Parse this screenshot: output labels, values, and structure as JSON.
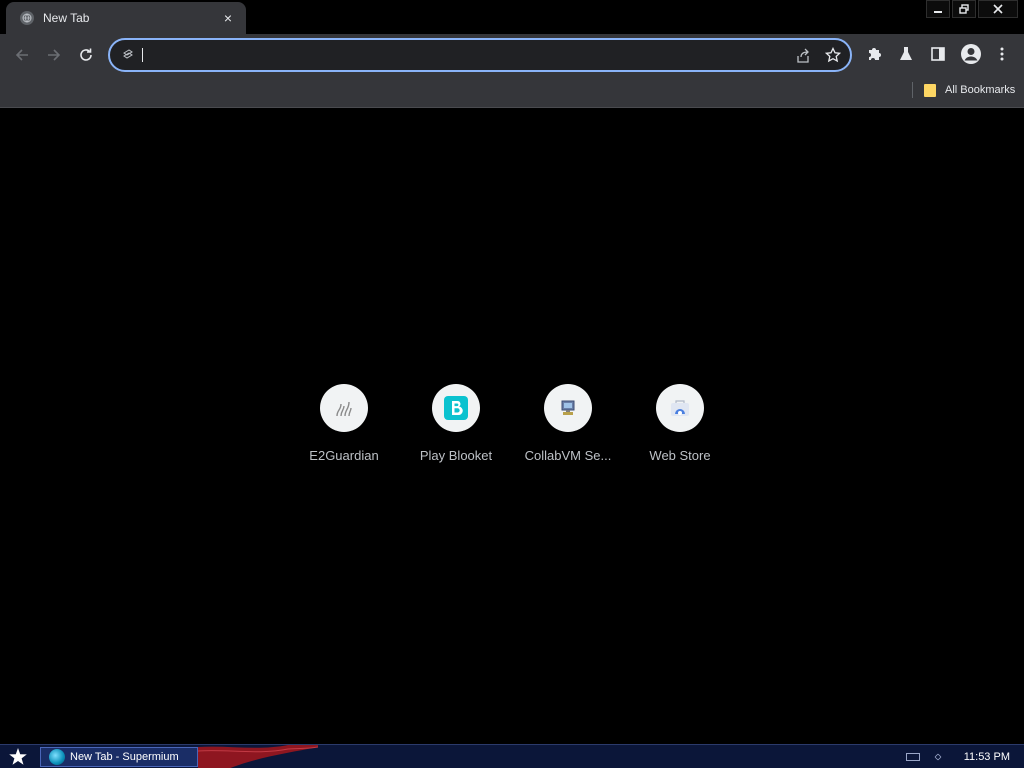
{
  "window": {
    "tab_title": "New Tab",
    "tab_close_glyph": "×",
    "controls": {
      "minimize": "minimize-icon",
      "restore": "restore-icon",
      "close": "close-icon"
    }
  },
  "toolbar": {
    "back_icon": "arrow-left-icon",
    "forward_icon": "arrow-right-icon",
    "reload_icon": "reload-icon",
    "omnibox": {
      "value": "",
      "placeholder": ""
    },
    "share_icon": "share-icon",
    "bookmark_star_icon": "star-icon",
    "extensions_icon": "puzzle-icon",
    "labs_icon": "flask-icon",
    "side_panel_icon": "side-panel-icon",
    "profile_icon": "avatar-icon",
    "menu_icon": "kebab-menu-icon",
    "accent_color": "#8ab4f8"
  },
  "bookmarks_bar": {
    "items": [
      {
        "label": "All Bookmarks"
      }
    ]
  },
  "shortcuts": [
    {
      "label": "E2Guardian"
    },
    {
      "label": "Play Blooket"
    },
    {
      "label": "CollabVM Se..."
    },
    {
      "label": "Web Store"
    }
  ],
  "taskbar": {
    "task_label": "New Tab - Supermium",
    "clock": "11:53 PM"
  }
}
